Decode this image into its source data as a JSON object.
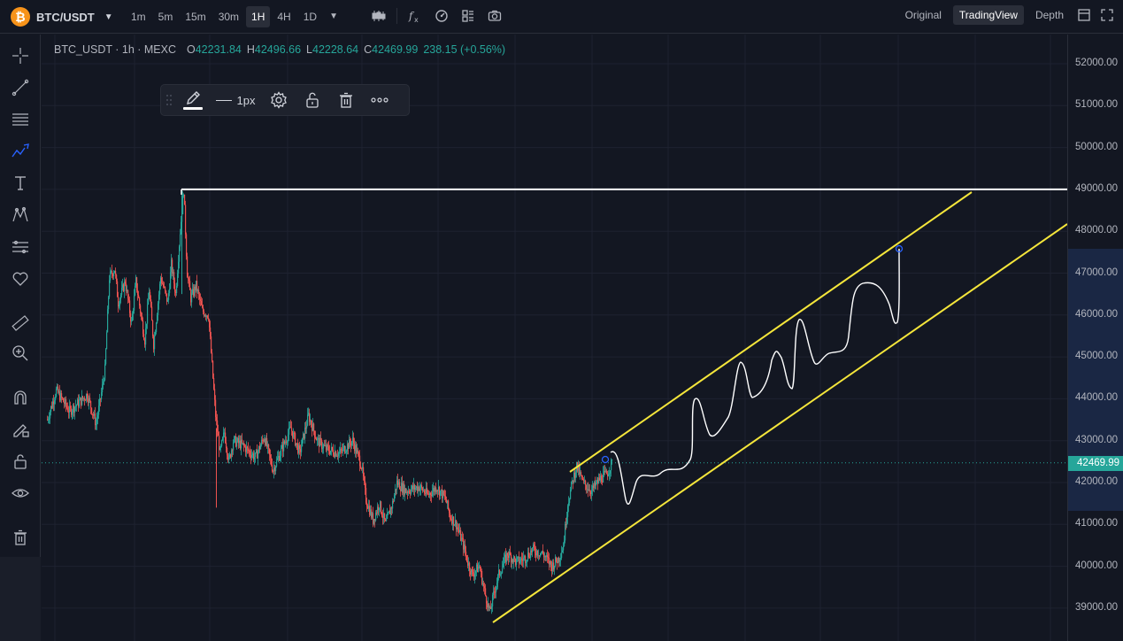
{
  "topbar": {
    "symbol": "BTC/USDT",
    "logo_glyph": "₿",
    "intervals": [
      "1m",
      "5m",
      "15m",
      "30m",
      "1H",
      "4H",
      "1D"
    ],
    "active_interval": "1H",
    "view_buttons": [
      "Original",
      "TradingView",
      "Depth"
    ],
    "active_view": "TradingView",
    "icons": [
      "candles-icon",
      "indicators-icon",
      "settings-icon",
      "layout-icon",
      "camera-icon"
    ]
  },
  "legend": {
    "name": "BTC_USDT · 1h · MEXC",
    "open_label": "O",
    "open": "42231.84",
    "high_label": "H",
    "high": "42496.66",
    "low_label": "L",
    "low": "42228.64",
    "close_label": "C",
    "close": "42469.99",
    "change": "238.15 (+0.56%)"
  },
  "floating_toolbar": {
    "width_label": "1px",
    "icons": [
      "pencil-icon",
      "line-style-icon",
      "gear-icon",
      "unlock-icon",
      "trash-icon",
      "more-icon"
    ]
  },
  "price_axis": {
    "labels": [
      "52000.00",
      "51000.00",
      "50000.00",
      "49000.00",
      "48000.00",
      "47000.00",
      "46000.00",
      "45000.00",
      "44000.00",
      "43000.00",
      "42000.00",
      "41000.00",
      "40000.00",
      "39000.00"
    ],
    "last_price": "42469.99"
  },
  "colors": {
    "background": "#131722",
    "up": "#26a69a",
    "down": "#ef5350",
    "channel": "#f5e63b",
    "resistance": "#ffffff"
  },
  "chart_data": {
    "type": "candlestick",
    "symbol": "BTC_USDT",
    "interval": "1h",
    "exchange": "MEXC",
    "last_price": 42469.99,
    "resistance_level": 49000,
    "ylim": [
      38700,
      52300
    ],
    "price_path": [
      [
        0,
        43500
      ],
      [
        10,
        44200
      ],
      [
        25,
        43700
      ],
      [
        45,
        44100
      ],
      [
        55,
        43400
      ],
      [
        60,
        44000
      ],
      [
        65,
        44700
      ],
      [
        70,
        46900
      ],
      [
        76,
        47100
      ],
      [
        80,
        46300
      ],
      [
        88,
        46800
      ],
      [
        95,
        45800
      ],
      [
        100,
        46800
      ],
      [
        110,
        45400
      ],
      [
        115,
        46600
      ],
      [
        120,
        45300
      ],
      [
        128,
        46900
      ],
      [
        136,
        46300
      ],
      [
        140,
        47200
      ],
      [
        145,
        46500
      ],
      [
        150,
        48000
      ],
      [
        154,
        49000
      ],
      [
        158,
        47000
      ],
      [
        162,
        46400
      ],
      [
        168,
        46700
      ],
      [
        175,
        46100
      ],
      [
        182,
        46000
      ],
      [
        186,
        44800
      ],
      [
        190,
        43600
      ],
      [
        195,
        42700
      ],
      [
        200,
        43200
      ],
      [
        205,
        42500
      ],
      [
        210,
        43000
      ],
      [
        220,
        42900
      ],
      [
        235,
        42600
      ],
      [
        245,
        43100
      ],
      [
        255,
        42300
      ],
      [
        265,
        42800
      ],
      [
        275,
        43300
      ],
      [
        285,
        42700
      ],
      [
        295,
        43600
      ],
      [
        305,
        43000
      ],
      [
        315,
        42800
      ],
      [
        330,
        42700
      ],
      [
        345,
        43000
      ],
      [
        355,
        42400
      ],
      [
        360,
        41600
      ],
      [
        368,
        41100
      ],
      [
        375,
        41500
      ],
      [
        382,
        41000
      ],
      [
        390,
        41500
      ],
      [
        395,
        42000
      ],
      [
        405,
        41800
      ],
      [
        420,
        41900
      ],
      [
        430,
        41700
      ],
      [
        440,
        41900
      ],
      [
        450,
        41600
      ],
      [
        455,
        41200
      ],
      [
        462,
        41000
      ],
      [
        470,
        40500
      ],
      [
        475,
        40100
      ],
      [
        480,
        39800
      ],
      [
        488,
        40000
      ],
      [
        495,
        39300
      ],
      [
        500,
        38900
      ],
      [
        505,
        39400
      ],
      [
        510,
        39800
      ],
      [
        520,
        40300
      ],
      [
        530,
        40100
      ],
      [
        540,
        40200
      ],
      [
        548,
        40400
      ],
      [
        560,
        40300
      ],
      [
        570,
        40000
      ],
      [
        578,
        40200
      ],
      [
        583,
        40500
      ],
      [
        588,
        41500
      ],
      [
        593,
        42000
      ],
      [
        598,
        42400
      ],
      [
        605,
        42000
      ],
      [
        615,
        41800
      ],
      [
        625,
        42100
      ],
      [
        632,
        42200
      ],
      [
        638,
        42470
      ]
    ]
  }
}
